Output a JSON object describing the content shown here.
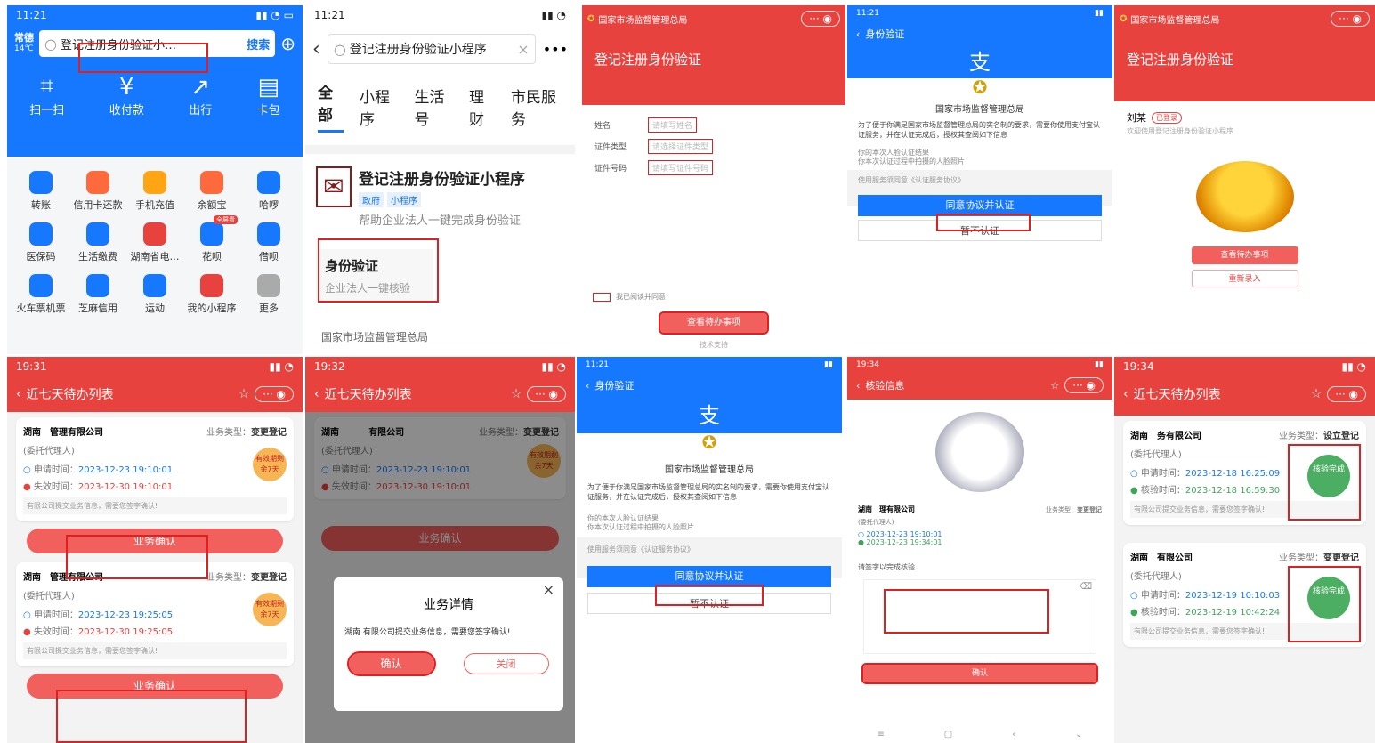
{
  "p1": {
    "time": "11:21",
    "city": "常德",
    "weather": "14℃",
    "search_value": "登记注册身份验证小…",
    "search_btn": "搜索",
    "top_actions": [
      {
        "label": "扫一扫",
        "icon": "scan-icon"
      },
      {
        "label": "收付款",
        "icon": "pay-icon"
      },
      {
        "label": "出行",
        "icon": "transit-icon"
      },
      {
        "label": "卡包",
        "icon": "card-wallet-icon"
      }
    ],
    "grid": [
      {
        "label": "转账",
        "icon": "transfer-icon",
        "color": "#1677ff"
      },
      {
        "label": "信用卡还款",
        "icon": "credit-card-icon",
        "color": "#ff6a3d"
      },
      {
        "label": "手机充值",
        "icon": "phone-icon",
        "color": "#ffa514"
      },
      {
        "label": "余额宝",
        "icon": "yuebao-icon",
        "color": "#ff6a3d"
      },
      {
        "label": "哈啰",
        "icon": "hello-icon",
        "color": "#1677ff"
      },
      {
        "label": "医保码",
        "icon": "medical-icon",
        "color": "#1677ff"
      },
      {
        "label": "生活缴费",
        "icon": "utility-icon",
        "color": "#1677ff"
      },
      {
        "label": "湖南省电…",
        "icon": "power-icon",
        "color": "#e8423f"
      },
      {
        "label": "花呗",
        "icon": "huabei-icon",
        "color": "#1677ff"
      },
      {
        "label": "借呗",
        "icon": "jiebei-icon",
        "color": "#1677ff"
      },
      {
        "label": "火车票机票",
        "icon": "train-icon",
        "color": "#1677ff"
      },
      {
        "label": "芝麻信用",
        "icon": "sesame-icon",
        "color": "#1677ff"
      },
      {
        "label": "运动",
        "icon": "sport-icon",
        "color": "#1677ff"
      },
      {
        "label": "我的小程序",
        "icon": "miniapp-icon",
        "color": "#e8423f"
      },
      {
        "label": "更多",
        "icon": "more-icon",
        "color": "#aaa"
      }
    ],
    "badge": "全屏看"
  },
  "p2": {
    "time": "11:21",
    "search_value": "登记注册身份验证小程序",
    "tabs": [
      "全部",
      "小程序",
      "生活号",
      "理财",
      "市民服务"
    ],
    "result_title": "登记注册身份验证小程序",
    "tag1": "政府",
    "tag2": "小程序",
    "desc": "帮助企业法人一键完成身份验证",
    "sub_title": "身份验证",
    "sub_desc": "企业法人一键核验",
    "footer": "国家市场监督管理总局"
  },
  "p3": {
    "header": "国家市场监督管理总局",
    "banner": "登记注册身份验证",
    "fields": [
      "姓名",
      "证件类型",
      "证件号码"
    ],
    "placeholders": [
      "请填写姓名",
      "请选择证件类型",
      "请填写证件号码"
    ],
    "agree": "我已阅读并同意",
    "btn": "查看待办事项",
    "tech": "技术支持"
  },
  "p4": {
    "time": "11:21",
    "nav": "身份验证",
    "org": "国家市场监督管理总局",
    "text": "为了便于你满足国家市场监督管理总局的实名制的要求，需要你使用支付宝认证服务，并在认证完成后，授权其查阅如下信息",
    "bullet1": "你的本次人脸认证结果",
    "bullet2": "你本次认证过程中拍摄的人脸照片",
    "agreement": "使用服务须同意《认证服务协议》",
    "btn_agree": "同意协议并认证",
    "btn_no": "暂不认证"
  },
  "p5": {
    "header": "国家市场监督管理总局",
    "banner": "登记注册身份验证",
    "greet": "刘某",
    "tag": "已登录",
    "sub": "欢迎使用登记注册身份验证小程序",
    "btn1": "查看待办事项",
    "btn2": "重新录入"
  },
  "p6": {
    "time": "19:31",
    "nav": "近七天待办列表",
    "cards": [
      {
        "prov": "湖南",
        "company": "管理有限公司",
        "type_label": "业务类型：",
        "type": "变更登记",
        "role": "(委托代理人)",
        "apply_label": "申请时间：",
        "apply": "2023-12-23 19:10:01",
        "expire_label": "失效时间：",
        "expire": "2023-12-30 19:10:01",
        "badge": "有效期剩余7天",
        "note": "有限公司提交业务信息，需要您签字确认!",
        "btn": "业务确认"
      },
      {
        "prov": "湖南",
        "company": "管理有限公司",
        "type_label": "业务类型：",
        "type": "变更登记",
        "role": "(委托代理人)",
        "apply_label": "申请时间：",
        "apply": "2023-12-23 19:25:05",
        "expire_label": "失效时间：",
        "expire": "2023-12-30 19:25:05",
        "badge": "有效期剩余7天",
        "note": "有限公司提交业务信息，需要您签字确认!",
        "btn": "业务确认"
      }
    ]
  },
  "p7": {
    "time": "19:32",
    "nav": "近七天待办列表",
    "prov": "湖南",
    "company": "有限公司",
    "type_label": "业务类型：",
    "type": "变更登记",
    "role": "(委托代理人)",
    "apply_label": "申请时间：",
    "apply": "2023-12-23 19:10:01",
    "expire_label": "失效时间：",
    "expire": "2023-12-30 19:10:01",
    "badge": "有效期剩余7天",
    "btn": "业务确认",
    "dlg_title": "业务详情",
    "dlg_text1": "湖南",
    "dlg_text2": "有限公司提交业务信息，需要您签字确认!",
    "dlg_ok": "确认",
    "dlg_close": "关闭"
  },
  "p8": {
    "time": "11:21",
    "nav": "身份验证",
    "org": "国家市场监督管理总局",
    "text": "为了便于你满足国家市场监督管理总局的实名制的要求，需要你使用支付宝认证服务，并在认证完成后，授权其查阅如下信息",
    "bullet1": "你的本次人脸认证结果",
    "bullet2": "你本次认证过程中拍摄的人脸照片",
    "agreement": "使用服务须同意《认证服务协议》",
    "btn_agree": "同意协议并认证",
    "btn_no": "暂不认证"
  },
  "p9": {
    "time": "19:34",
    "nav": "核验信息",
    "prov": "湖南",
    "company": "理有限公司",
    "type_label": "业务类型：",
    "type": "变更登记",
    "role": "(委托代理人)",
    "apply": "2023-12-23 19:10:01",
    "verify": "2023-12-23 19:34:01",
    "prompt": "请签字以完成核验",
    "btn": "确认"
  },
  "p10": {
    "time": "19:34",
    "nav": "近七天待办列表",
    "cards": [
      {
        "prov": "湖南",
        "company": "务有限公司",
        "type_label": "业务类型：",
        "type": "设立登记",
        "role": "(委托代理人)",
        "apply_label": "申请时间：",
        "apply": "2023-12-18 16:25:09",
        "verify_label": "核验时间：",
        "verify": "2023-12-18 16:59:30",
        "badge": "核验完成",
        "note": "有限公司提交业务信息，需要您签字确认!"
      },
      {
        "prov": "湖南",
        "company": "有限公司",
        "type_label": "业务类型：",
        "type": "变更登记",
        "role": "(委托代理人)",
        "apply_label": "申请时间：",
        "apply": "2023-12-19 10:10:03",
        "verify_label": "核验时间：",
        "verify": "2023-12-19 10:42:24",
        "badge": "核验完成",
        "note": "有限公司提交业务信息，需要您签字确认!"
      }
    ]
  }
}
